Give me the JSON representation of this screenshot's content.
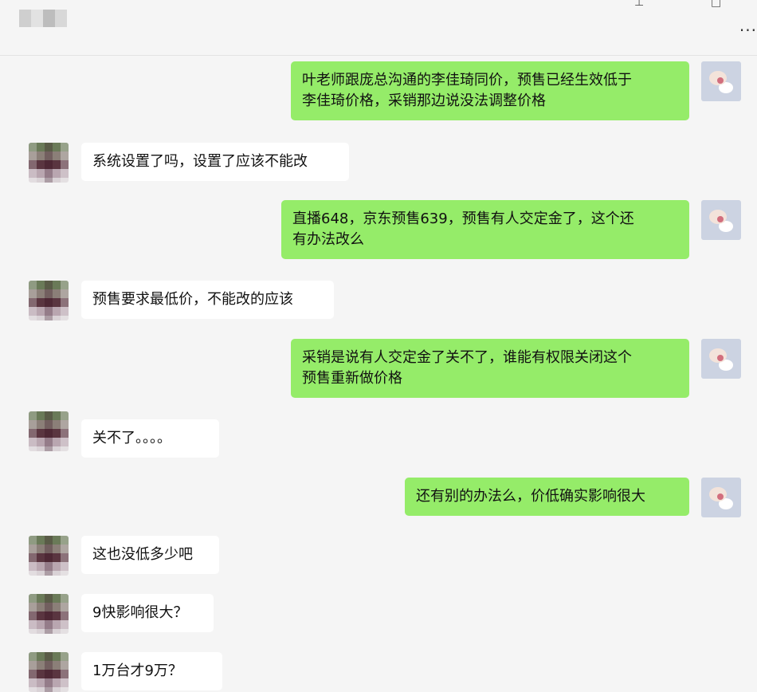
{
  "header": {
    "contact_name": "",
    "pin_icon": "pin-icon",
    "maximize_icon": "maximize-icon",
    "more_label": "..."
  },
  "messages": [
    {
      "sender": "self",
      "text": "叶老师跟庞总沟通的李佳琦同价，预售已经生效低于\n李佳琦价格，采销那边说没法调整价格"
    },
    {
      "sender": "other",
      "text": "系统设置了吗，设置了应该不能改"
    },
    {
      "sender": "self",
      "text": "直播648，京东预售639，预售有人交定金了，这个还\n有办法改么"
    },
    {
      "sender": "other",
      "text": "预售要求最低价，不能改的应该"
    },
    {
      "sender": "self",
      "text": "采销是说有人交定金了关不了，谁能有权限关闭这个\n预售重新做价格"
    },
    {
      "sender": "other",
      "text": "关不了。。。。"
    },
    {
      "sender": "self",
      "text": "还有别的办法么，价低确实影响很大"
    },
    {
      "sender": "other",
      "text": "这也没低多少吧"
    },
    {
      "sender": "other",
      "text": "9快影响很大？"
    },
    {
      "sender": "other",
      "text": "1万台才9万？"
    }
  ],
  "colors": {
    "self_bubble": "#95ec69",
    "other_bubble": "#ffffff",
    "background": "#f5f5f5"
  }
}
